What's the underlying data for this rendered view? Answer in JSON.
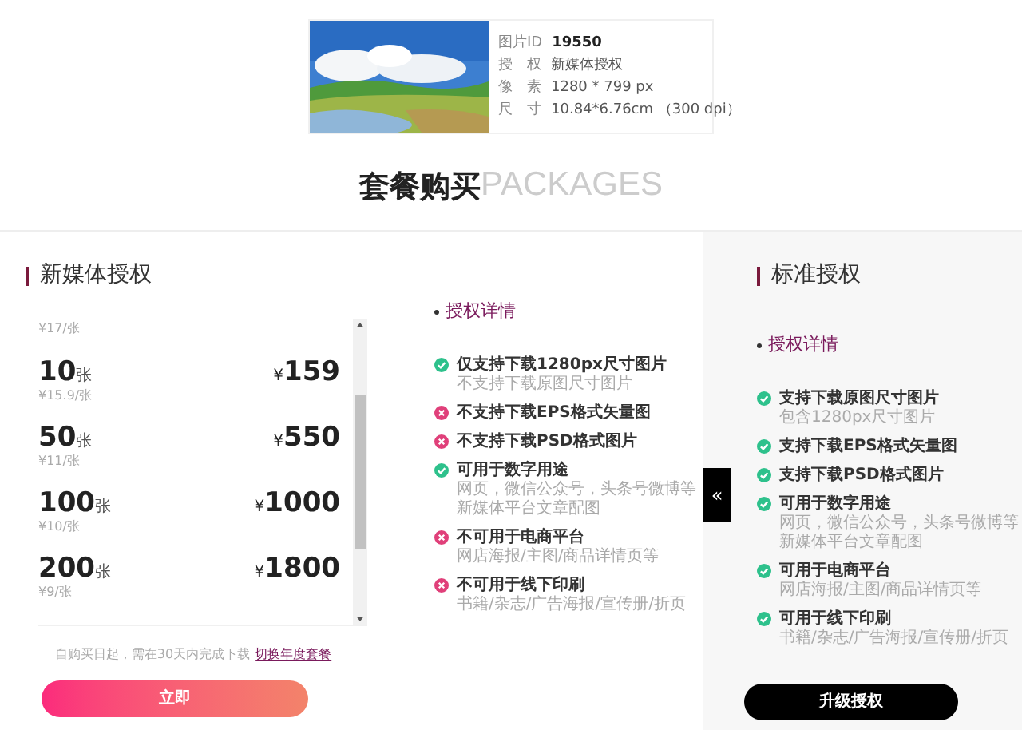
{
  "image_info": {
    "rows": [
      {
        "label": "图片ID",
        "value": "19550"
      },
      {
        "label": "授　权",
        "value": "新媒体授权"
      },
      {
        "label": "像　素",
        "value": "1280 * 799 px"
      },
      {
        "label": "尺　寸",
        "value": "10.84*6.76cm （300 dpi）"
      }
    ]
  },
  "heading": {
    "main": "套餐购买",
    "sub": "PACKAGES"
  },
  "new_media": {
    "title": "新媒体授权",
    "partial_unit_price": "¥17/张",
    "packages": [
      {
        "count": "10",
        "unit": "张",
        "unit_price": "¥15.9/张",
        "currency": "¥",
        "price": "159"
      },
      {
        "count": "50",
        "unit": "张",
        "unit_price": "¥11/张",
        "currency": "¥",
        "price": "550"
      },
      {
        "count": "100",
        "unit": "张",
        "unit_price": "¥10/张",
        "currency": "¥",
        "price": "1000"
      },
      {
        "count": "200",
        "unit": "张",
        "unit_price": "¥9/张",
        "currency": "¥",
        "price": "1800"
      }
    ],
    "note": "自购买日起，需在30天内完成下载",
    "note_link": "切换年度套餐",
    "buy_button": "立即",
    "details_title": "授权详情",
    "features": [
      {
        "allowed": true,
        "title": "仅支持下载1280px尺寸图片",
        "desc": "不支持下载原图尺寸图片"
      },
      {
        "allowed": false,
        "title": "不支持下载EPS格式矢量图"
      },
      {
        "allowed": false,
        "title": "不支持下载PSD格式图片"
      },
      {
        "allowed": true,
        "title": "可用于数字用途",
        "desc": "网页，微信公众号，头条号微博等新媒体平台文章配图"
      },
      {
        "allowed": false,
        "title": "不可用于电商平台",
        "desc": "网店海报/主图/商品详情页等"
      },
      {
        "allowed": false,
        "title": "不可用于线下印刷",
        "desc": "书籍/杂志/广告海报/宣传册/折页"
      }
    ]
  },
  "collapse_tab": "«",
  "standard": {
    "title": "标准授权",
    "details_title": "授权详情",
    "features": [
      {
        "allowed": true,
        "title": "支持下载原图尺寸图片",
        "desc": "包含1280px尺寸图片"
      },
      {
        "allowed": true,
        "title": "支持下载EPS格式矢量图"
      },
      {
        "allowed": true,
        "title": "支持下载PSD格式图片"
      },
      {
        "allowed": true,
        "title": "可用于数字用途",
        "desc": "网页，微信公众号，头条号微博等新媒体平台文章配图"
      },
      {
        "allowed": true,
        "title": "可用于电商平台",
        "desc": "网店海报/主图/商品详情页等"
      },
      {
        "allowed": true,
        "title": "可用于线下印刷",
        "desc": "书籍/杂志/广告海报/宣传册/折页"
      }
    ],
    "upgrade_button": "升级授权"
  }
}
